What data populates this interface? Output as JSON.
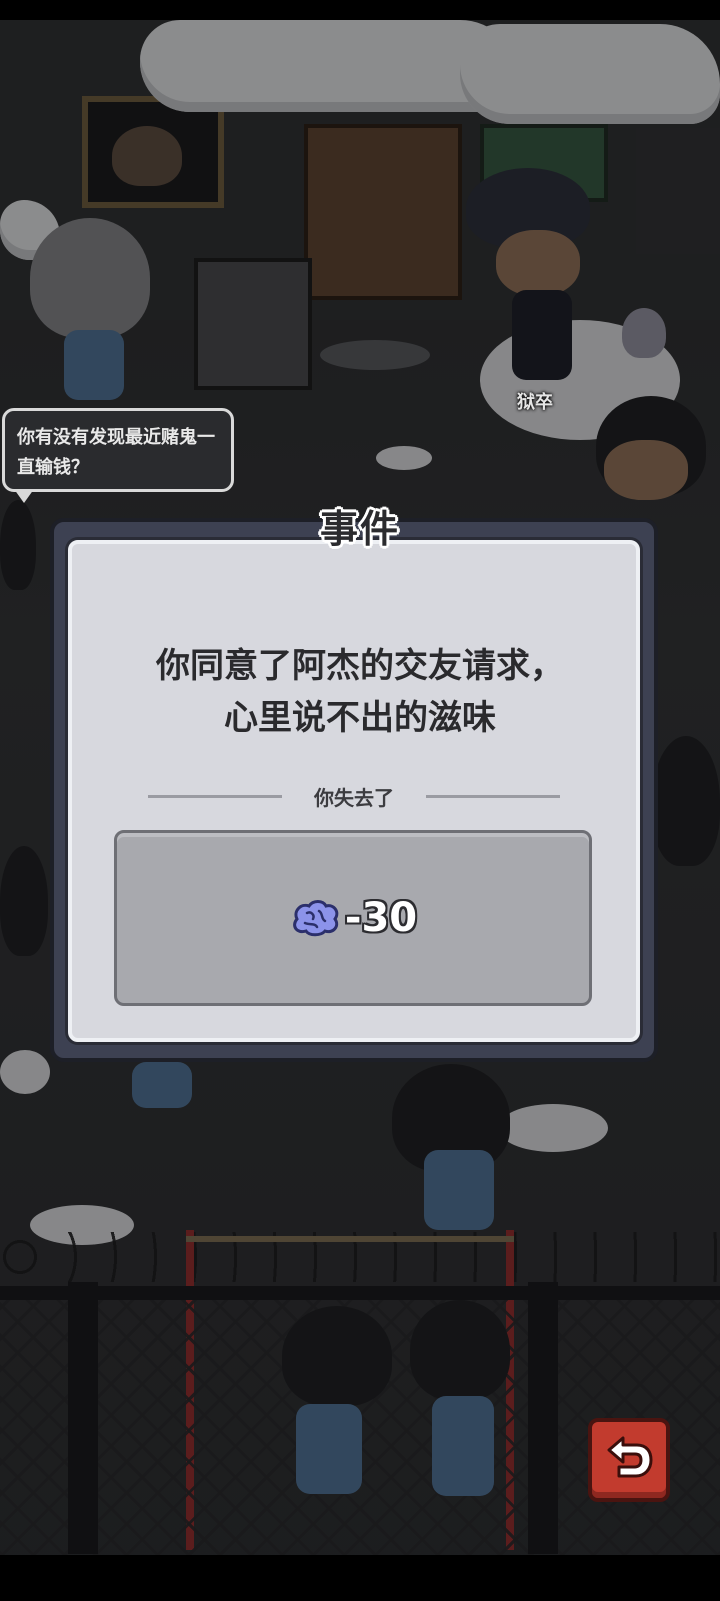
{
  "scene": {
    "npc_speech": "你有没有发现最近赌鬼一直输钱？",
    "guard_label": "狱卒"
  },
  "event_dialog": {
    "title": "事件",
    "message_line1": "你同意了阿杰的交友请求，",
    "message_line2": "心里说不出的滋味",
    "loss_header": "你失去了",
    "loss_items": [
      {
        "icon": "brain-icon",
        "value": "-30"
      }
    ]
  },
  "controls": {
    "back_icon": "return-arrow-icon"
  },
  "colors": {
    "dialog_frame": "#3d4152",
    "dialog_panel": "#d7d8de",
    "loss_box": "#a8a9ae",
    "back_button": "#c23b2e",
    "brain_icon": "#8c93ea"
  }
}
